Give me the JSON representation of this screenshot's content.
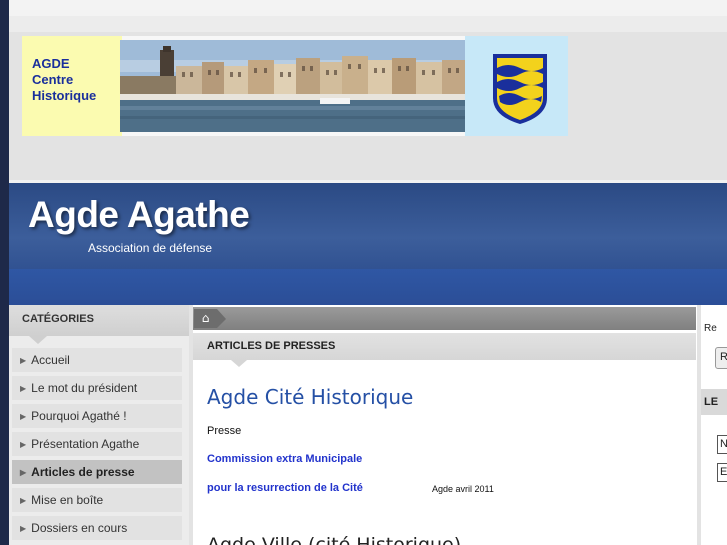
{
  "banner": {
    "text_lines": [
      "AGDE",
      "Centre",
      "Historique"
    ]
  },
  "site": {
    "title": "Agde Agathe",
    "subtitle": "Association de défense"
  },
  "sidebar": {
    "heading": "CATÉGORIES",
    "items": [
      {
        "label": "Accueil"
      },
      {
        "label": "Le mot du président"
      },
      {
        "label": "Pourquoi Agathé !"
      },
      {
        "label": "Présentation Agathe"
      },
      {
        "label": "Articles de presse"
      },
      {
        "label": "Mise en boîte"
      },
      {
        "label": "Dossiers en cours"
      }
    ],
    "active_index": 4
  },
  "content": {
    "section_heading": "ARTICLES DE PRESSES",
    "article_title": "Agde Cité Historique",
    "article_label": "Presse",
    "link_1": "Commission extra Municipale",
    "link_2": "pour la resurrection de la Cité",
    "date": "Agde avril 2011",
    "next_title": "Agde Ville (cité Historique)"
  },
  "right_column": {
    "text": "Re",
    "button_label": "R",
    "heading": "LE",
    "input_1": "N",
    "input_2": "E"
  },
  "icons": {
    "home": "home-icon",
    "bullet": "triangle-right-icon"
  },
  "colors": {
    "header_blue": "#2b4a84",
    "title_blue": "#2550a5",
    "link_blue": "#2233cc",
    "banner_yellow": "#fbfbb0"
  }
}
